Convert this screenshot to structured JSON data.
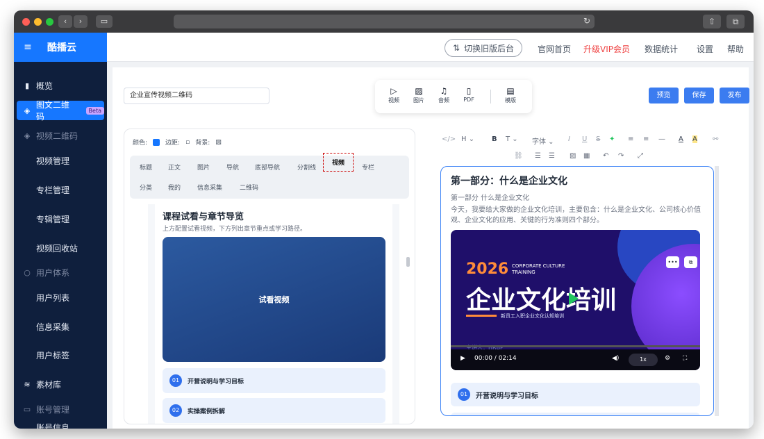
{
  "sidebar": {
    "brand": "酷播云",
    "items": [
      {
        "label": "概览",
        "icon": "bar-chart-icon"
      },
      {
        "label": "图文二维码",
        "icon": "cube-icon",
        "badge": "Beta"
      },
      {
        "label": "视频二维码",
        "icon": "cube-icon"
      },
      {
        "label": "视频管理"
      },
      {
        "label": "专栏管理"
      },
      {
        "label": "专辑管理"
      },
      {
        "label": "视频回收站"
      },
      {
        "label": "用户体系",
        "icon": "user-icon"
      },
      {
        "label": "用户列表"
      },
      {
        "label": "信息采集"
      },
      {
        "label": "用户标签"
      },
      {
        "label": "素材库",
        "icon": "layers-icon"
      },
      {
        "label": "账号管理",
        "icon": "id-card-icon"
      },
      {
        "label": "账号信息"
      }
    ]
  },
  "topbar": {
    "switch_label": "切换旧版后台",
    "links": [
      "官网首页",
      "升级VIP会员",
      "数据统计",
      "设置",
      "帮助"
    ]
  },
  "editor": {
    "title_value": "企业宣传视频二维码",
    "tools": [
      "视频",
      "图片",
      "音频",
      "PDF",
      "模版"
    ],
    "actions": [
      "预览",
      "保存",
      "发布"
    ]
  },
  "left_panel": {
    "opts": [
      "颜色:",
      "边距:",
      "背景:"
    ],
    "tabs": [
      "标题",
      "正文",
      "图片",
      "导航",
      "底部导航",
      "分割线",
      "视频",
      "专栏",
      "分类",
      "我的",
      "信息采集",
      "二维码"
    ],
    "selected_tab": "视频",
    "section_title": "课程试看与章节导览",
    "section_sub": "上方配置试看视频，下方列出章节重点或学习路径。",
    "video_label": "试看视频",
    "chapters": [
      {
        "num": "01",
        "title": "开营说明与学习目标"
      },
      {
        "num": "02",
        "title": "实操案例拆解"
      }
    ]
  },
  "right_panel": {
    "title": "第一部分：什么是企业文化",
    "subtitle": "第一部分 什么是企业文化",
    "paragraph": "今天，我要给大家做的企业文化培训，主要包含：什么是企业文化、公司核心价值观、企业文化的应用、关键的行为准则四个部分。",
    "toolbar": {
      "heading": "H",
      "bold": "B",
      "font_size": "T",
      "font_family": "字体",
      "italic": "I",
      "underline": "U",
      "strike": "S",
      "code": "</>"
    },
    "player": {
      "year": "2026",
      "en_line1": "CORPORATE CULTURE",
      "en_line2": "TRAINING",
      "big_title": "企业文化培训",
      "small_caption": "新员工入职企业文化认知培训",
      "speaker": "主讲人：HRBP",
      "time": "00:00 / 02:14",
      "speed": "1x",
      "progress": 0
    },
    "chapters": [
      {
        "num": "01",
        "title": "开营说明与学习目标"
      }
    ]
  }
}
